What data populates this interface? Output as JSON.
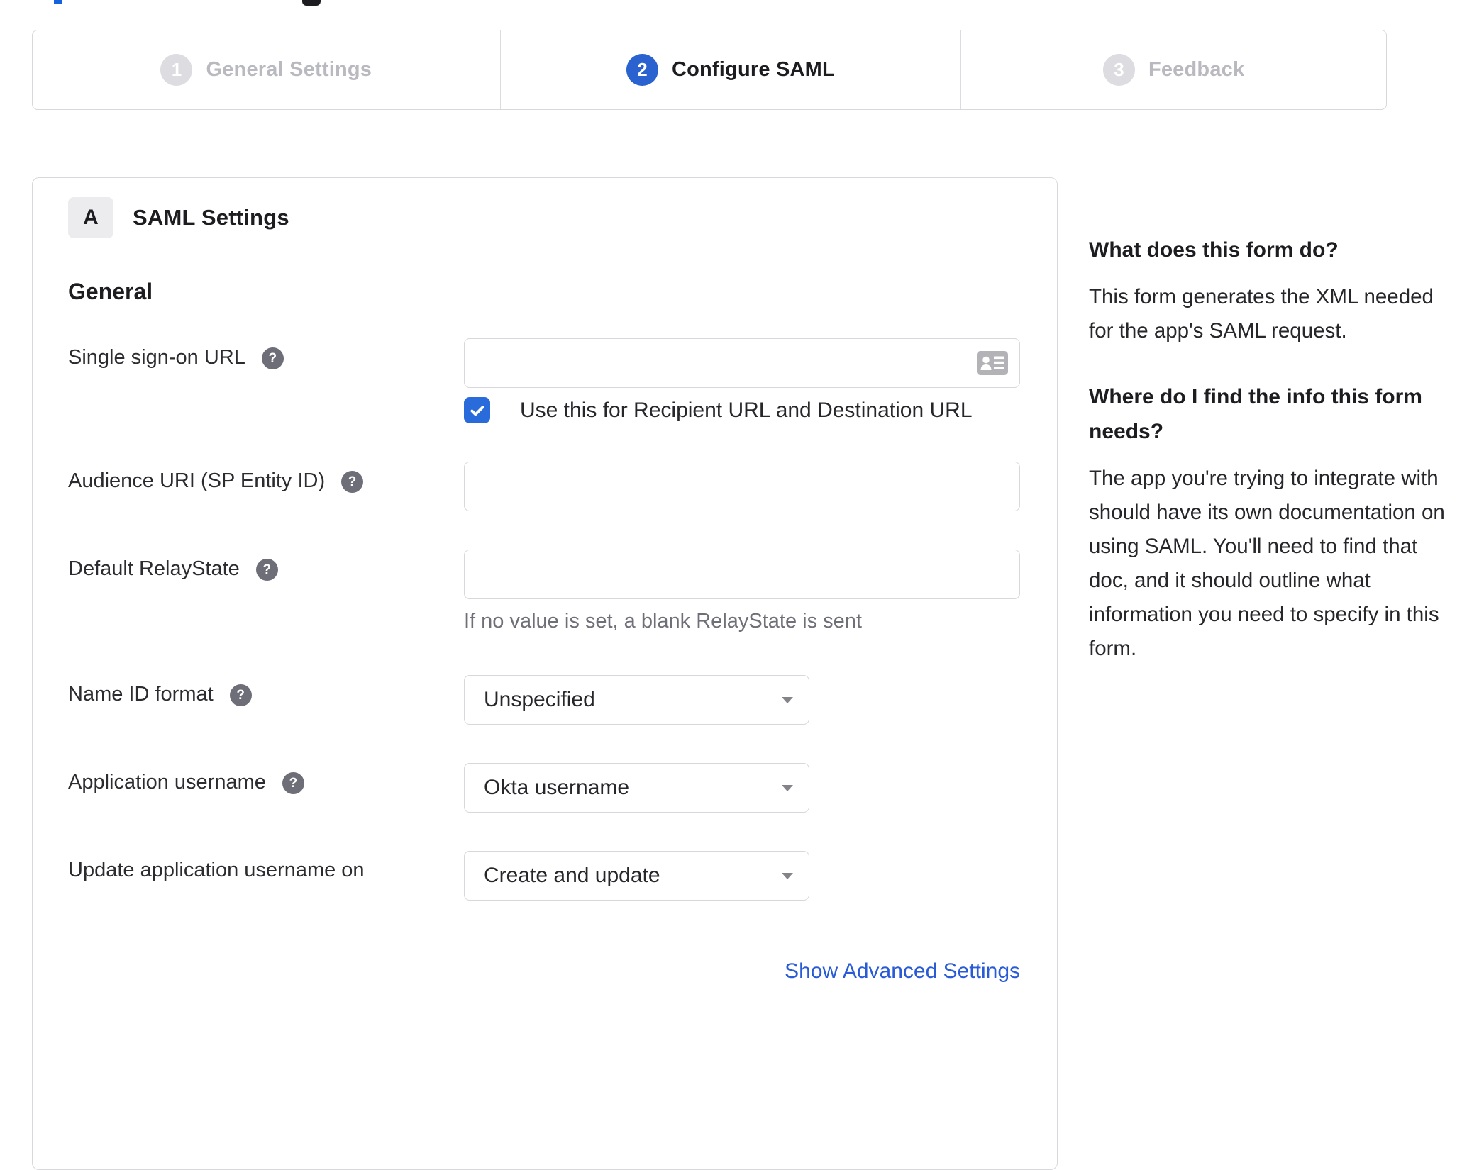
{
  "icons": {
    "help_glyph": "?"
  },
  "colors": {
    "accent_blue": "#2a62d0",
    "checkbox_blue": "#2a6bdb",
    "link_blue": "#2a5bd7",
    "border_gray": "#d7d7dc",
    "inactive_gray": "#dcdce1"
  },
  "stepper": {
    "steps": [
      {
        "number": "1",
        "label": "General Settings",
        "state": "inactive"
      },
      {
        "number": "2",
        "label": "Configure SAML",
        "state": "active"
      },
      {
        "number": "3",
        "label": "Feedback",
        "state": "inactive"
      }
    ]
  },
  "panel": {
    "section_badge": "A",
    "section_title": "SAML Settings",
    "group_heading": "General",
    "fields": [
      {
        "label": "Single sign-on URL",
        "type": "text",
        "value": "",
        "checkbox_label": "Use this for Recipient URL and Destination URL",
        "checkbox_checked": true
      },
      {
        "label": "Audience URI (SP Entity ID)",
        "type": "text",
        "value": ""
      },
      {
        "label": "Default RelayState",
        "type": "text",
        "value": "",
        "hint": "If no value is set, a blank RelayState is sent"
      },
      {
        "label": "Name ID format",
        "type": "select",
        "value": "Unspecified"
      },
      {
        "label": "Application username",
        "type": "select",
        "value": "Okta username"
      },
      {
        "label": "Update application username on",
        "type": "select",
        "value": "Create and update"
      }
    ],
    "advanced_link": "Show Advanced Settings"
  },
  "help_sidebar": {
    "sections": [
      {
        "heading": "What does this form do?",
        "body": "This form generates the XML needed for the app's SAML request."
      },
      {
        "heading": "Where do I find the info this form needs?",
        "body": "The app you're trying to integrate with should have its own documentation on using SAML. You'll need to find that doc, and it should outline what information you need to specify in this form."
      }
    ]
  }
}
